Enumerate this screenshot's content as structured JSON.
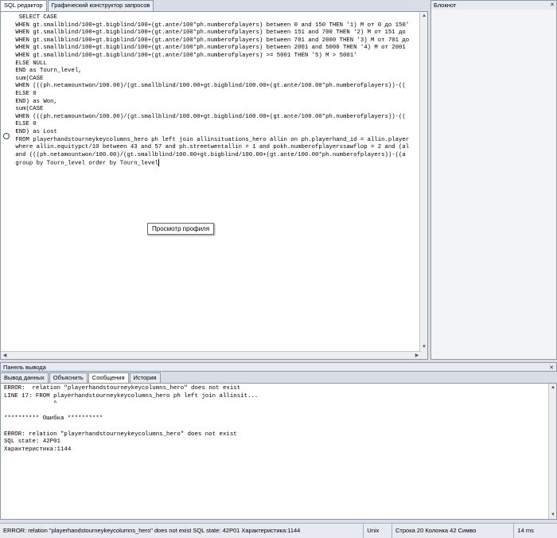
{
  "editor_tabs": [
    "SQL редактор",
    "Графический конструктор запросов"
  ],
  "sql_lines": [
    "  SELECT CASE",
    " WHEN gt.smallblind/100+gt.bigblind/100+(gt.ante/100*ph.numberofplayers) between 0 and 150 THEN '1) M от 0 до 150'",
    " WHEN gt.smallblind/100+gt.bigblind/100+(gt.ante/100*ph.numberofplayers) between 151 and 700 THEN '2) M от 151 до",
    " WHEN gt.smallblind/100+gt.bigblind/100+(gt.ante/100*ph.numberofplayers) between 701 and 2000 THEN '3) M от 701 до",
    " WHEN gt.smallblind/100+gt.bigblind/100+(gt.ante/100*ph.numberofplayers) between 2001 and 5000 THEN '4) M от 2001",
    " WHEN gt.smallblind/100+gt.bigblind/100+(gt.ante/100*ph.numberofplayers) >= 5001 THEN '5) M > 5001'",
    " ELSE NULL",
    " END as Tourn_level,",
    " sum(CASE",
    " WHEN (((ph.netamountwon/100.00)/(gt.smallblind/100.00+gt.bigblind/100.00+(gt.ante/100.00*ph.numberofplayers))-((",
    " ELSE 0",
    " END) as Won,",
    " sum(CASE",
    " WHEN (((ph.netamountwon/100.00)/(gt.smallblind/100.00+gt.bigblind/100.00+(gt.ante/100.00*ph.numberofplayers))-((",
    " ELSE 0",
    " END) as Lost",
    " FROM playerhandstourneykeycolumns_hero ph left join allinsituations_hero allin on ph.playerhand_id = allin.player",
    " where allin.equitypct/10 between 43 and 57 and ph.streetwentallin = 1 and pokh.numberofplayerssawflop = 2 and (al",
    " and (((ph.netamountwon/100.00)/(gt.smallblind/100.00+gt.bigblind/100.00+(gt.ante/100.00*ph.numberofplayers))-((a",
    " group by Tourn_level order by Tourn_level"
  ],
  "tooltip": "Просмотр профиля",
  "notepad_title": "Блокнот",
  "output_panel_title": "Панель вывода",
  "output_tabs": [
    "Вывод данных",
    "Объяснить",
    "Сообщения",
    "История"
  ],
  "output_lines": [
    "ERROR:  relation \"playerhandstourneykeycolumns_hero\" does not exist",
    "LINE 17: FROM playerhandstourneykeycolumns_hero ph left join allinsit...",
    "              ^",
    "",
    "********** Ошибка **********",
    "",
    "ERROR: relation \"playerhandstourneykeycolumns_hero\" does not exist",
    "SQL state: 42P01",
    "Характеристика:1144"
  ],
  "status": {
    "message": "ERROR: relation \"playerhandstourneykeycolumns_hero\" does not exist SQL state: 42P01 Характеристика:1144",
    "line_ending": "Unix",
    "position": "Строка 20 Колонка 42 Симво",
    "time": "14 ms"
  }
}
